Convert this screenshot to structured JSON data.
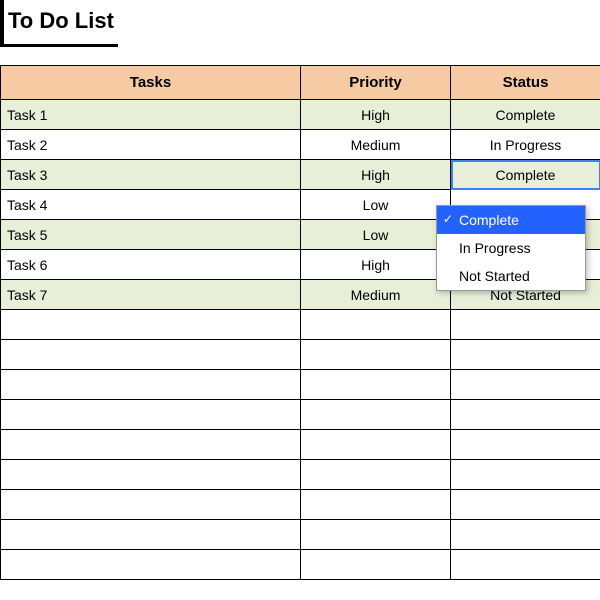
{
  "title": "To Do List",
  "columns": {
    "tasks": "Tasks",
    "priority": "Priority",
    "status": "Status"
  },
  "rows": [
    {
      "task": "Task 1",
      "priority": "High",
      "status": "Complete"
    },
    {
      "task": "Task 2",
      "priority": "Medium",
      "status": "In Progress"
    },
    {
      "task": "Task 3",
      "priority": "High",
      "status": "Complete"
    },
    {
      "task": "Task 4",
      "priority": "Low",
      "status": ""
    },
    {
      "task": "Task 5",
      "priority": "Low",
      "status": ""
    },
    {
      "task": "Task 6",
      "priority": "High",
      "status": ""
    },
    {
      "task": "Task 7",
      "priority": "Medium",
      "status": "Not Started"
    }
  ],
  "empty_rows": 9,
  "active_cell": {
    "row": 2,
    "col": "status"
  },
  "dropdown": {
    "open": true,
    "selected": "Complete",
    "options": [
      "Complete",
      "In Progress",
      "Not Started"
    ]
  }
}
